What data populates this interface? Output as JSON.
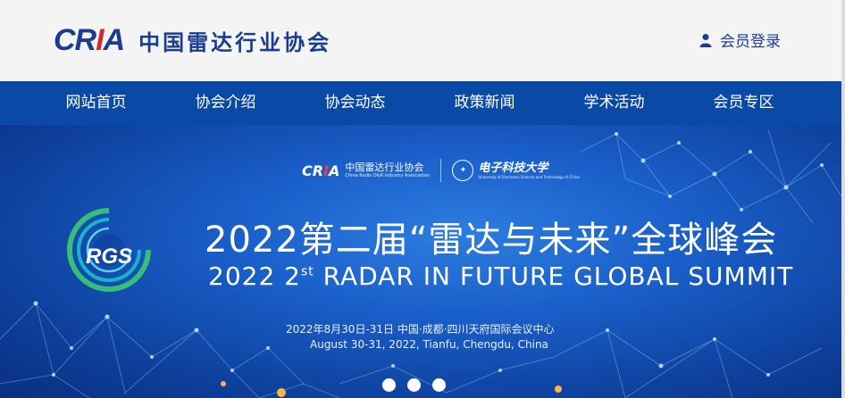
{
  "header": {
    "logo_mark_prefix": "CR",
    "logo_mark_accent": "I",
    "logo_mark_suffix": "A",
    "org_name": "中国雷达行业协会",
    "login_label": "会员登录"
  },
  "nav": {
    "items": [
      {
        "label": "网站首页"
      },
      {
        "label": "协会介绍"
      },
      {
        "label": "协会动态"
      },
      {
        "label": "政策新闻"
      },
      {
        "label": "学术活动"
      },
      {
        "label": "会员专区"
      }
    ]
  },
  "banner": {
    "partner1_mark_prefix": "CR",
    "partner1_mark_accent": "I",
    "partner1_mark_suffix": "A",
    "partner1_name": "中国雷达行业协会",
    "partner1_en": "China Radio D&R Industry Association",
    "partner2_name": "电子科技大学",
    "partner2_en": "University of Electronic Science and Technology of China",
    "rgs_label": "RGS",
    "title_cn": "2022第二届“雷达与未来”全球峰会",
    "title_en_year": "2022 2",
    "title_en_sup": "st",
    "title_en_rest": " RADAR IN FUTURE GLOBAL SUMMIT",
    "date_cn": "2022年8月30日-31日  中国·成都·四川天府国际会议中心",
    "date_en": "August 30-31, 2022, Tianfu, Chengdu, China",
    "slide_count": 3
  },
  "colors": {
    "brand_blue": "#1a3d8f",
    "nav_bg": "#0a4aa6",
    "accent_red": "#d62a2a",
    "banner_blue": "#1a5fc9"
  },
  "icons": {
    "login": "user-icon"
  }
}
